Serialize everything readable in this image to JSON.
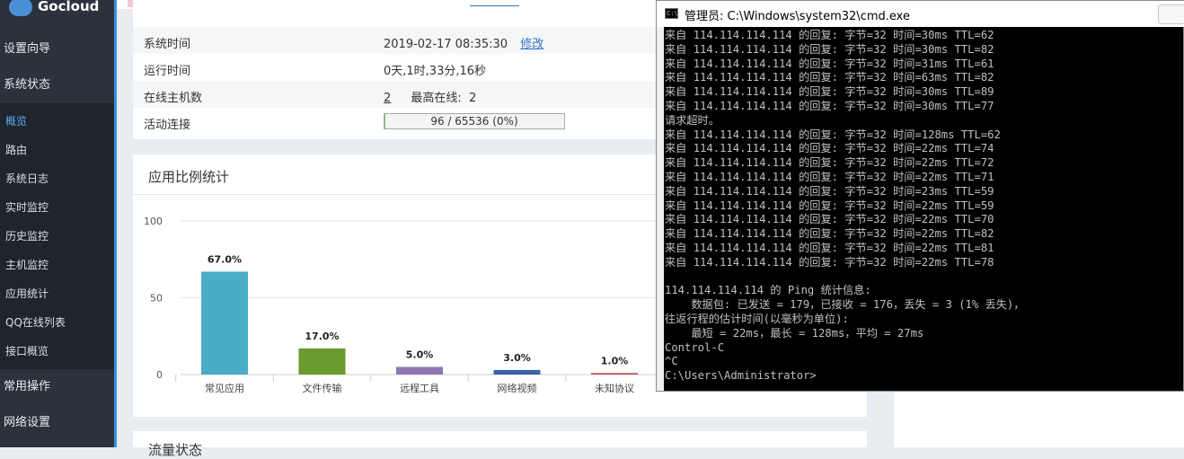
{
  "brand": {
    "logo_text": "Gocloud"
  },
  "sidebar": {
    "groups_top": [
      {
        "label": "设置向导"
      },
      {
        "label": "系统状态"
      }
    ],
    "items": [
      {
        "label": "概览",
        "active": true
      },
      {
        "label": "路由"
      },
      {
        "label": "系统日志"
      },
      {
        "label": "实时监控"
      },
      {
        "label": "历史监控"
      },
      {
        "label": "主机监控"
      },
      {
        "label": "应用统计"
      },
      {
        "label": "QQ在线列表"
      },
      {
        "label": "接口概览"
      }
    ],
    "groups_bottom": [
      {
        "label": "常用操作"
      },
      {
        "label": "网络设置"
      }
    ]
  },
  "info": {
    "system_time_label": "系统时间",
    "system_time_value": "2019-02-17 08:35:30",
    "modify_link": "修改",
    "uptime_label": "运行时间",
    "uptime_value": "0天,1时,33分,16秒",
    "online_hosts_label": "在线主机数",
    "online_hosts_value": "2",
    "max_online_label": "最高在线:",
    "max_online_value": "2",
    "connections_label": "活动连接",
    "connections_value": "96 / 65536 (0%)",
    "connections_fraction": 0.0015
  },
  "chart_section": {
    "title": "应用比例统计"
  },
  "chart_data": {
    "type": "bar",
    "categories": [
      "常见应用",
      "文件传输",
      "远程工具",
      "网络视频",
      "未知协议"
    ],
    "values": [
      67.0,
      17.0,
      5.0,
      3.0,
      1.0
    ],
    "data_labels": [
      "67.0%",
      "17.0%",
      "5.0%",
      "3.0%",
      "1.0%"
    ],
    "bar_colors": [
      "#4bacc6",
      "#6b9a2e",
      "#8e76b3",
      "#3a63a8",
      "#c0504d"
    ],
    "ytick_labels": [
      "0",
      "50",
      "100"
    ],
    "yticks": [
      0,
      50,
      100
    ],
    "ylim": [
      0,
      100
    ],
    "grid": true
  },
  "bottom_section": {
    "title": "流量状态"
  },
  "cmd": {
    "title": "管理员: C:\\Windows\\system32\\cmd.exe",
    "lines": [
      "来自 114.114.114.114 的回复: 字节=32 时间=30ms TTL=62",
      "来自 114.114.114.114 的回复: 字节=32 时间=30ms TTL=82",
      "来自 114.114.114.114 的回复: 字节=32 时间=31ms TTL=61",
      "来自 114.114.114.114 的回复: 字节=32 时间=63ms TTL=82",
      "来自 114.114.114.114 的回复: 字节=32 时间=30ms TTL=89",
      "来自 114.114.114.114 的回复: 字节=32 时间=30ms TTL=77",
      "请求超时。",
      "来自 114.114.114.114 的回复: 字节=32 时间=128ms TTL=62",
      "来自 114.114.114.114 的回复: 字节=32 时间=22ms TTL=74",
      "来自 114.114.114.114 的回复: 字节=32 时间=22ms TTL=72",
      "来自 114.114.114.114 的回复: 字节=32 时间=22ms TTL=71",
      "来自 114.114.114.114 的回复: 字节=32 时间=23ms TTL=59",
      "来自 114.114.114.114 的回复: 字节=32 时间=22ms TTL=59",
      "来自 114.114.114.114 的回复: 字节=32 时间=22ms TTL=70",
      "来自 114.114.114.114 的回复: 字节=32 时间=22ms TTL=82",
      "来自 114.114.114.114 的回复: 字节=32 时间=22ms TTL=81",
      "来自 114.114.114.114 的回复: 字节=32 时间=22ms TTL=78",
      "",
      "114.114.114.114 的 Ping 统计信息:",
      "    数据包: 已发送 = 179，已接收 = 176，丢失 = 3 (1% 丢失)，",
      "往返行程的估计时间(以毫秒为单位):",
      "    最短 = 22ms，最长 = 128ms，平均 = 27ms",
      "Control-C",
      "^C",
      "C:\\Users\\Administrator>"
    ]
  }
}
